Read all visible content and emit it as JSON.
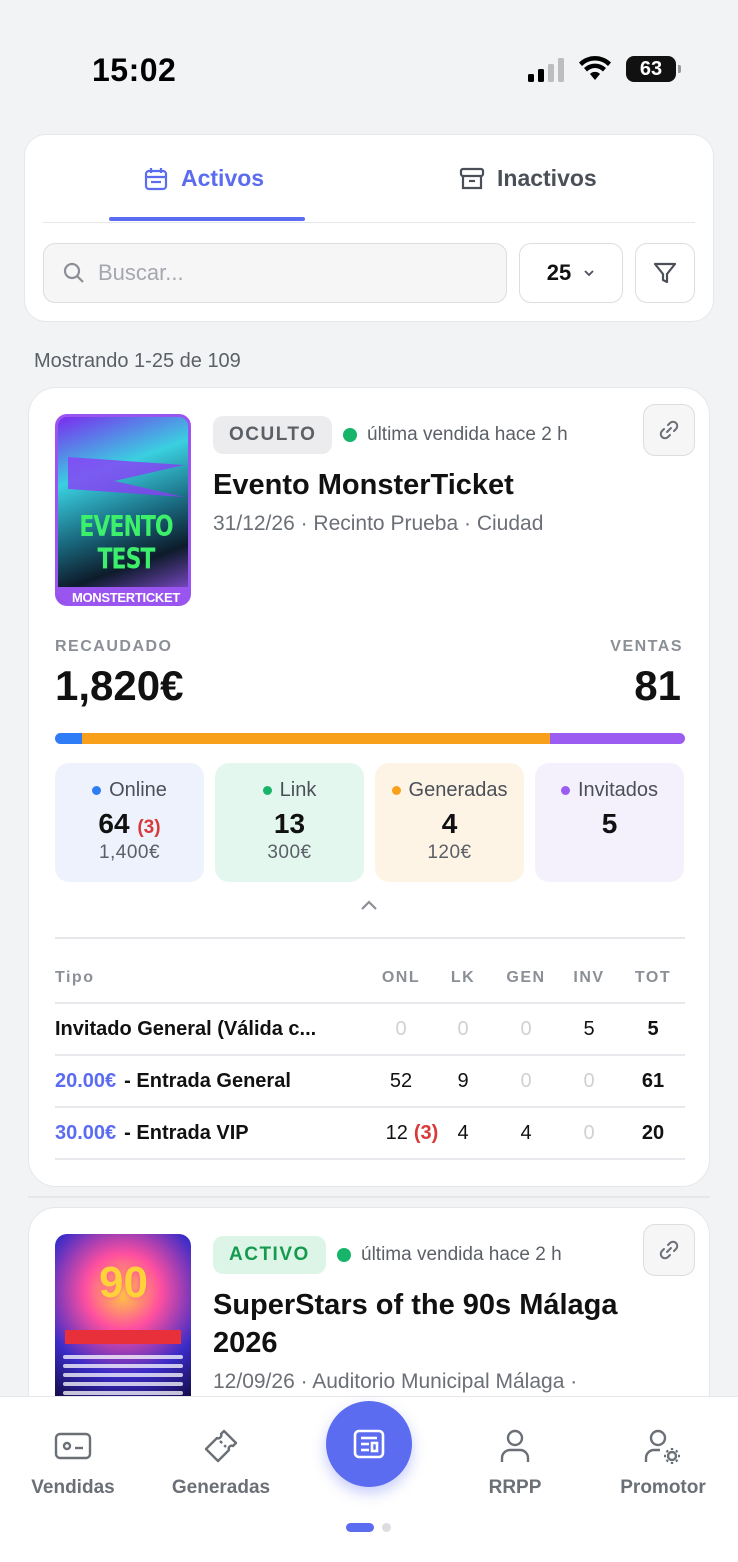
{
  "status_bar": {
    "time": "15:02",
    "battery": "63"
  },
  "tabs": {
    "active_label": "Activos",
    "inactive_label": "Inactivos"
  },
  "search": {
    "placeholder": "Buscar..."
  },
  "page_size": {
    "value": "25"
  },
  "results": {
    "showing_text": "Mostrando 1-25 de 109"
  },
  "event1": {
    "poster": {
      "title": "EVENTO TEST",
      "footer": "MONSTERTICKET"
    },
    "status_badge": "OCULTO",
    "last_sale": "última vendida hace 2 h",
    "title": "Evento MonsterTicket",
    "meta": "31/12/26 · Recinto Prueba · Ciudad",
    "raised_label": "RECAUDADO",
    "raised_value": "1,820€",
    "sales_label": "VENTAS",
    "sales_value": "81",
    "progress_fractions": {
      "online": 0.043,
      "link_generadas": 0.742,
      "invitados": 0.215
    },
    "colors": {
      "online": "#2f7df6",
      "link": "#18b46a",
      "generadas": "#f8a01b",
      "invitados": "#9b5cf2"
    },
    "stats": {
      "online": {
        "label": "Online",
        "count": "64",
        "alert": "(3)",
        "amount": "1,400€"
      },
      "link": {
        "label": "Link",
        "count": "13",
        "amount": "300€"
      },
      "generadas": {
        "label": "Generadas",
        "count": "4",
        "amount": "120€"
      },
      "invitados": {
        "label": "Invitados",
        "count": "5"
      }
    },
    "table": {
      "headers": {
        "type": "Tipo",
        "onl": "ONL",
        "lk": "LK",
        "gen": "GEN",
        "inv": "INV",
        "tot": "TOT"
      },
      "rows": [
        {
          "price": "",
          "name": "Invitado General (Válida c...",
          "onl": "0",
          "lk": "0",
          "gen": "0",
          "inv": "5",
          "tot": "5"
        },
        {
          "price": "20.00€",
          "name": "- Entrada General",
          "onl": "52",
          "lk": "9",
          "gen": "0",
          "inv": "0",
          "tot": "61"
        },
        {
          "price": "30.00€",
          "name": "- Entrada VIP",
          "onl": "12",
          "onl_alert": "(3)",
          "lk": "4",
          "gen": "4",
          "inv": "0",
          "tot": "20"
        }
      ]
    }
  },
  "event2": {
    "status_badge": "ACTIVO",
    "last_sale": "última vendida hace  2 h",
    "title": "SuperStars of the 90s Málaga 2026",
    "meta": "12/09/26 · Auditorio Municipal Málaga ·",
    "poster": {
      "headline": "90"
    }
  },
  "bottom_nav": {
    "sold": "Vendidas",
    "generated": "Generadas",
    "rrpp": "RRPP",
    "promoter": "Promotor"
  }
}
